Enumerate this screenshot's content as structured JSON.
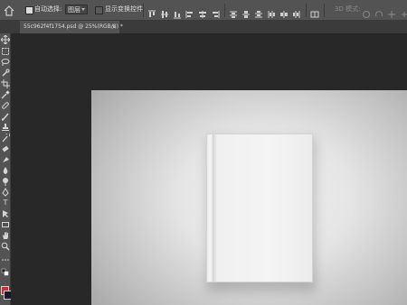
{
  "options_bar": {
    "auto_select_label": "自动选择:",
    "auto_select_value": "图层",
    "show_transform_label": "显示变换控件",
    "mode_3d_label": "3D 模式:"
  },
  "document_tab": {
    "title": "55c962f4f1754.psd @ 25%(RGB/8) *",
    "close": "×"
  },
  "tools": {
    "text_tool": "T"
  },
  "colors": {
    "foreground": "#c8303c",
    "background": "#1a1a2a"
  }
}
